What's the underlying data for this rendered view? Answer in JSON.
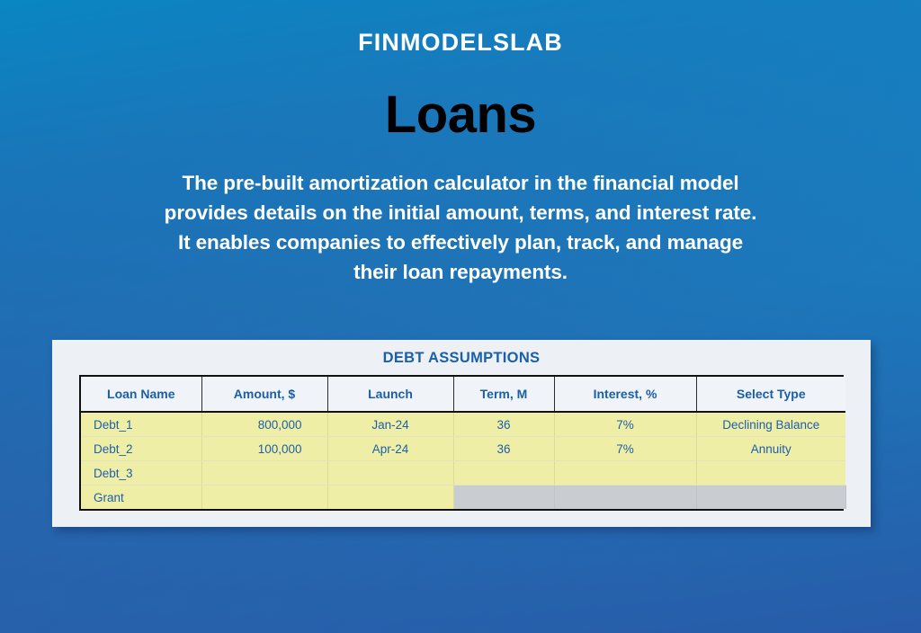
{
  "brand": {
    "name": "FINMODELSLAB"
  },
  "hero": {
    "title": "Loans",
    "description_lines": [
      "The pre-built amortization calculator in the financial model",
      "provides details on the initial amount, terms, and interest rate.",
      "It enables companies to effectively plan, track, and manage",
      "their loan repayments."
    ]
  },
  "panel": {
    "title": "DEBT ASSUMPTIONS",
    "columns": [
      "Loan Name",
      "Amount, $",
      "Launch",
      "Term, M",
      "Interest, %",
      "Select Type"
    ],
    "rows": [
      {
        "loan_name": "Debt_1",
        "amount": "800,000",
        "launch": "Jan-24",
        "term": "36",
        "interest": "7%",
        "select_type": "Declining Balance",
        "blocked": []
      },
      {
        "loan_name": "Debt_2",
        "amount": "100,000",
        "launch": "Apr-24",
        "term": "36",
        "interest": "7%",
        "select_type": "Annuity",
        "blocked": []
      },
      {
        "loan_name": "Debt_3",
        "amount": "",
        "launch": "",
        "term": "",
        "interest": "",
        "select_type": "",
        "blocked": []
      },
      {
        "loan_name": "Grant",
        "amount": "",
        "launch": "",
        "term": "",
        "interest": "",
        "select_type": "",
        "blocked": [
          "term",
          "interest",
          "select_type"
        ]
      }
    ]
  },
  "colors": {
    "background_top": "#1686c4",
    "background_bottom": "#2b54a4",
    "panel_bg": "#edf1f5",
    "table_cell_yellow": "#eeeea6",
    "table_cell_gray": "#c9cdd1",
    "accent_blue": "#1a5fa8",
    "data_text_blue": "#1f5fa9",
    "title_black": "#000000",
    "brand_white": "#ffffff"
  }
}
